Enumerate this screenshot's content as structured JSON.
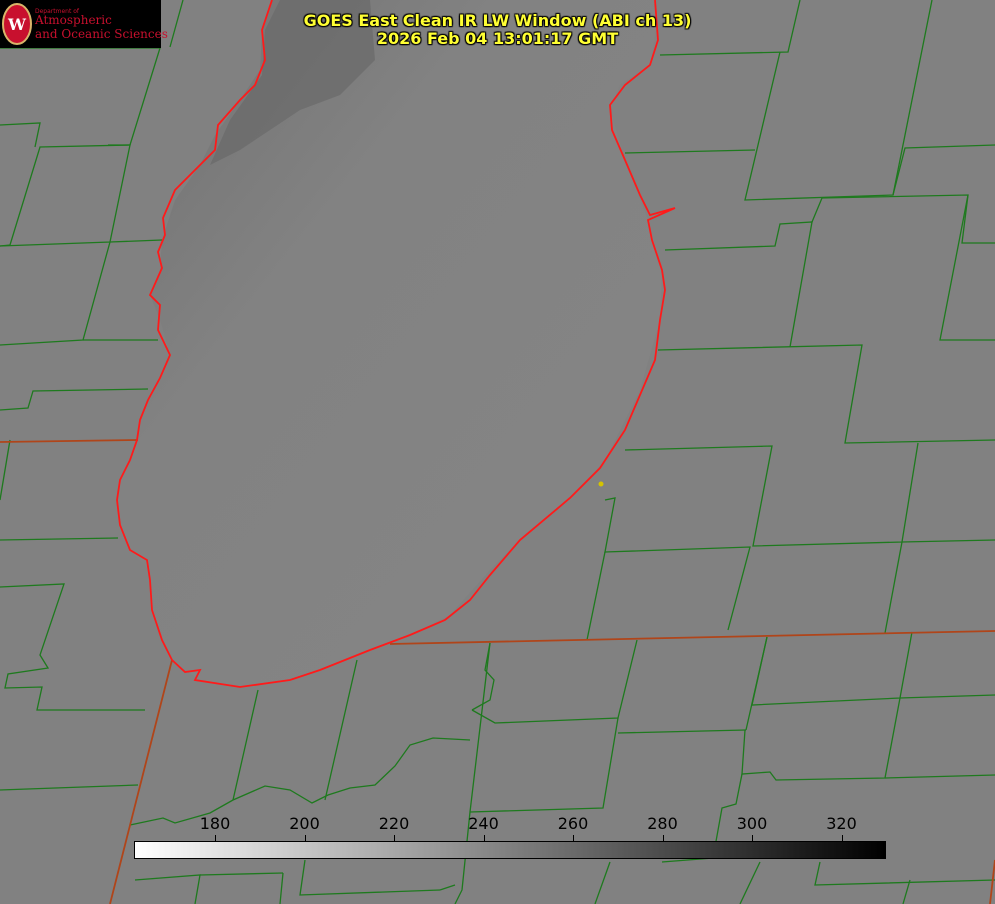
{
  "title": {
    "line1": "GOES East Clean IR LW Window (ABI ch 13)",
    "line2": "2026 Feb 04 13:01:17 GMT"
  },
  "logo": {
    "small": "Department of",
    "line1": "Atmospheric",
    "line2": "and Oceanic Sciences",
    "shield_letter": "W"
  },
  "colorbar": {
    "ticks": [
      "180",
      "200",
      "220",
      "240",
      "260",
      "280",
      "300",
      "320"
    ],
    "start_color": "#ffffff",
    "end_color": "#000000"
  },
  "colors": {
    "county_lines": "#1e7a1e",
    "shoreline": "#ff1a1a",
    "title_text": "#ffff33",
    "background_gray": "#808080"
  }
}
